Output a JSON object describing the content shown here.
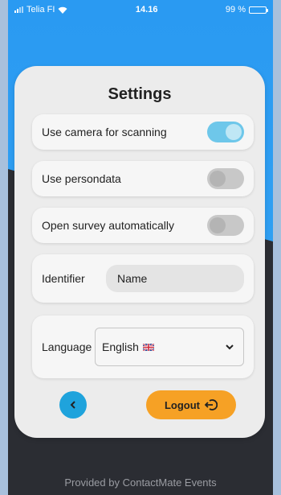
{
  "status": {
    "carrier": "Telia FI",
    "time": "14.16",
    "battery": "99 %"
  },
  "settings": {
    "title": "Settings",
    "camera": {
      "label": "Use camera for scanning",
      "enabled": true
    },
    "persondata": {
      "label": "Use persondata",
      "enabled": false
    },
    "survey": {
      "label": "Open survey automatically",
      "enabled": false
    },
    "identifier": {
      "label": "Identifier",
      "value": "Name"
    },
    "language": {
      "label": "Language",
      "value": "English",
      "flag_icon": "uk-flag-icon"
    }
  },
  "actions": {
    "back_icon": "chevron-left-icon",
    "logout_label": "Logout",
    "logout_icon": "logout-icon"
  },
  "footer": {
    "text": "Provided by ContactMate Events"
  },
  "colors": {
    "primary_blue": "#2a9af2",
    "toggle_on": "#6ec7ea",
    "back_button": "#1fa3dc",
    "logout_button": "#f6a125",
    "dark_bg": "#2b2d33"
  }
}
